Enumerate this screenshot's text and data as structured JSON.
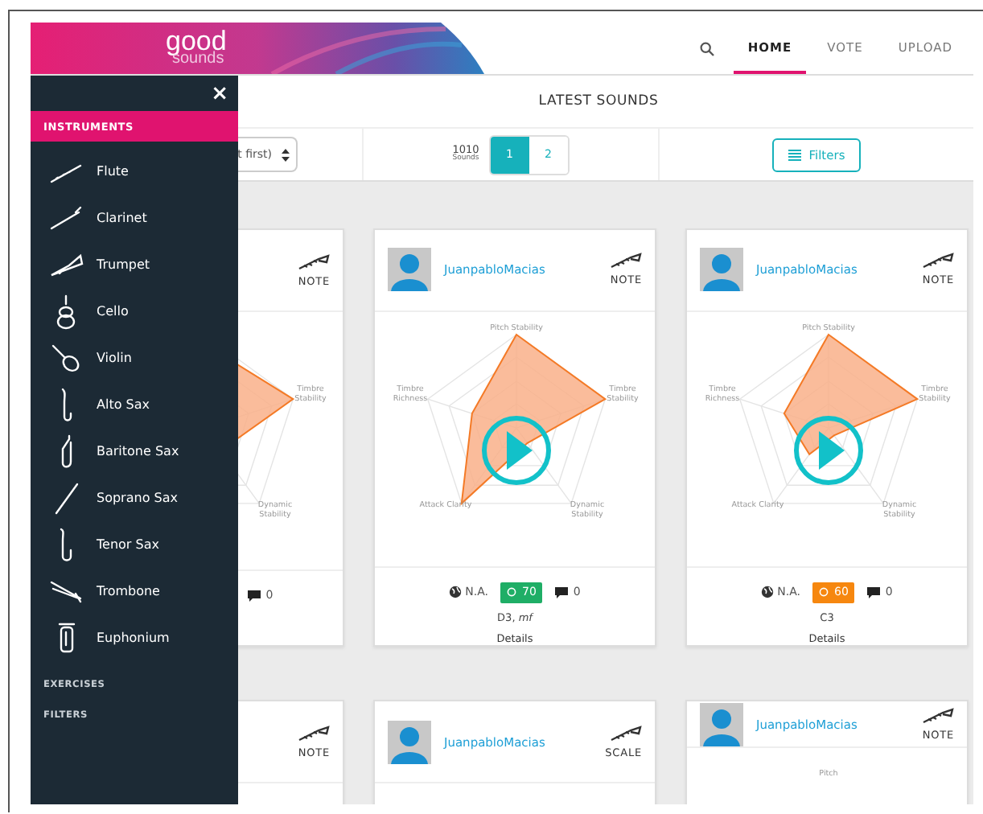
{
  "logo": {
    "line_1": "good",
    "line_2": "sounds"
  },
  "nav": [
    {
      "label": "HOME",
      "selected": true
    },
    {
      "label": "VOTE",
      "selected": false
    },
    {
      "label": "UPLOAD",
      "selected": false
    }
  ],
  "toolbar": {
    "title": "LATEST SOUNDS",
    "sort": "t first)",
    "count": "1010",
    "count_label": "Sounds",
    "pages": [
      {
        "label": "1",
        "selected": true
      },
      {
        "label": "2",
        "selected": false
      }
    ],
    "filters_button": "Filters"
  },
  "cards": [
    {
      "type": "NOTE",
      "radar_labels": [
        {
          "text": "Timbre Stability",
          "kind": "right"
        },
        {
          "text": "Dynamic Stability",
          "kind": "lower-right"
        }
      ],
      "comments": "0"
    },
    {
      "user": "JuanpabloMacias",
      "type": "NOTE",
      "radar_labels": [
        {
          "text": "Pitch Stability",
          "kind": "top"
        },
        {
          "text": "Timbre Richness",
          "kind": "left"
        },
        {
          "text": "Timbre Stability",
          "kind": "right"
        },
        {
          "text": "Attack Clarity",
          "kind": "lower-left"
        },
        {
          "text": "Dynamic Stability",
          "kind": "lower-right"
        }
      ],
      "location": "N.A.",
      "score": {
        "text": "70",
        "color": "#1fae66"
      },
      "comments": "0",
      "note": "D3, *mf*",
      "details": "Details"
    },
    {
      "user": "JuanpabloMacias",
      "type": "NOTE",
      "radar_labels": [
        {
          "text": "Pitch Stability",
          "kind": "top"
        },
        {
          "text": "Timbre Richness",
          "kind": "left"
        },
        {
          "text": "Timbre Stability",
          "kind": "right"
        },
        {
          "text": "Attack Clarity",
          "kind": "lower-left"
        },
        {
          "text": "Dynamic Stability",
          "kind": "lower-right"
        }
      ],
      "location": "N.A.",
      "score": {
        "text": "60",
        "color": "#f6870f"
      },
      "comments": "0",
      "note": "C3",
      "details": "Details"
    },
    {
      "type": "NOTE"
    },
    {
      "user": "JuanpabloMacias",
      "type": "SCALE"
    },
    {
      "user": "JuanpabloMacias",
      "type": "NOTE",
      "radar_labels": [
        {
          "text": "Pitch",
          "kind": "top"
        }
      ]
    }
  ],
  "sidebar": {
    "close": "×",
    "heading": {
      "label": "INSTRUMENTS",
      "selected": true
    },
    "items": [
      "Flute",
      "Clarinet",
      "Trumpet",
      "Cello",
      "Violin",
      "Alto Sax",
      "Baritone Sax",
      "Soprano Sax",
      "Tenor Sax",
      "Trombone",
      "Euphonium"
    ],
    "sections": [
      "EXERCISES",
      "FILTERS"
    ]
  }
}
